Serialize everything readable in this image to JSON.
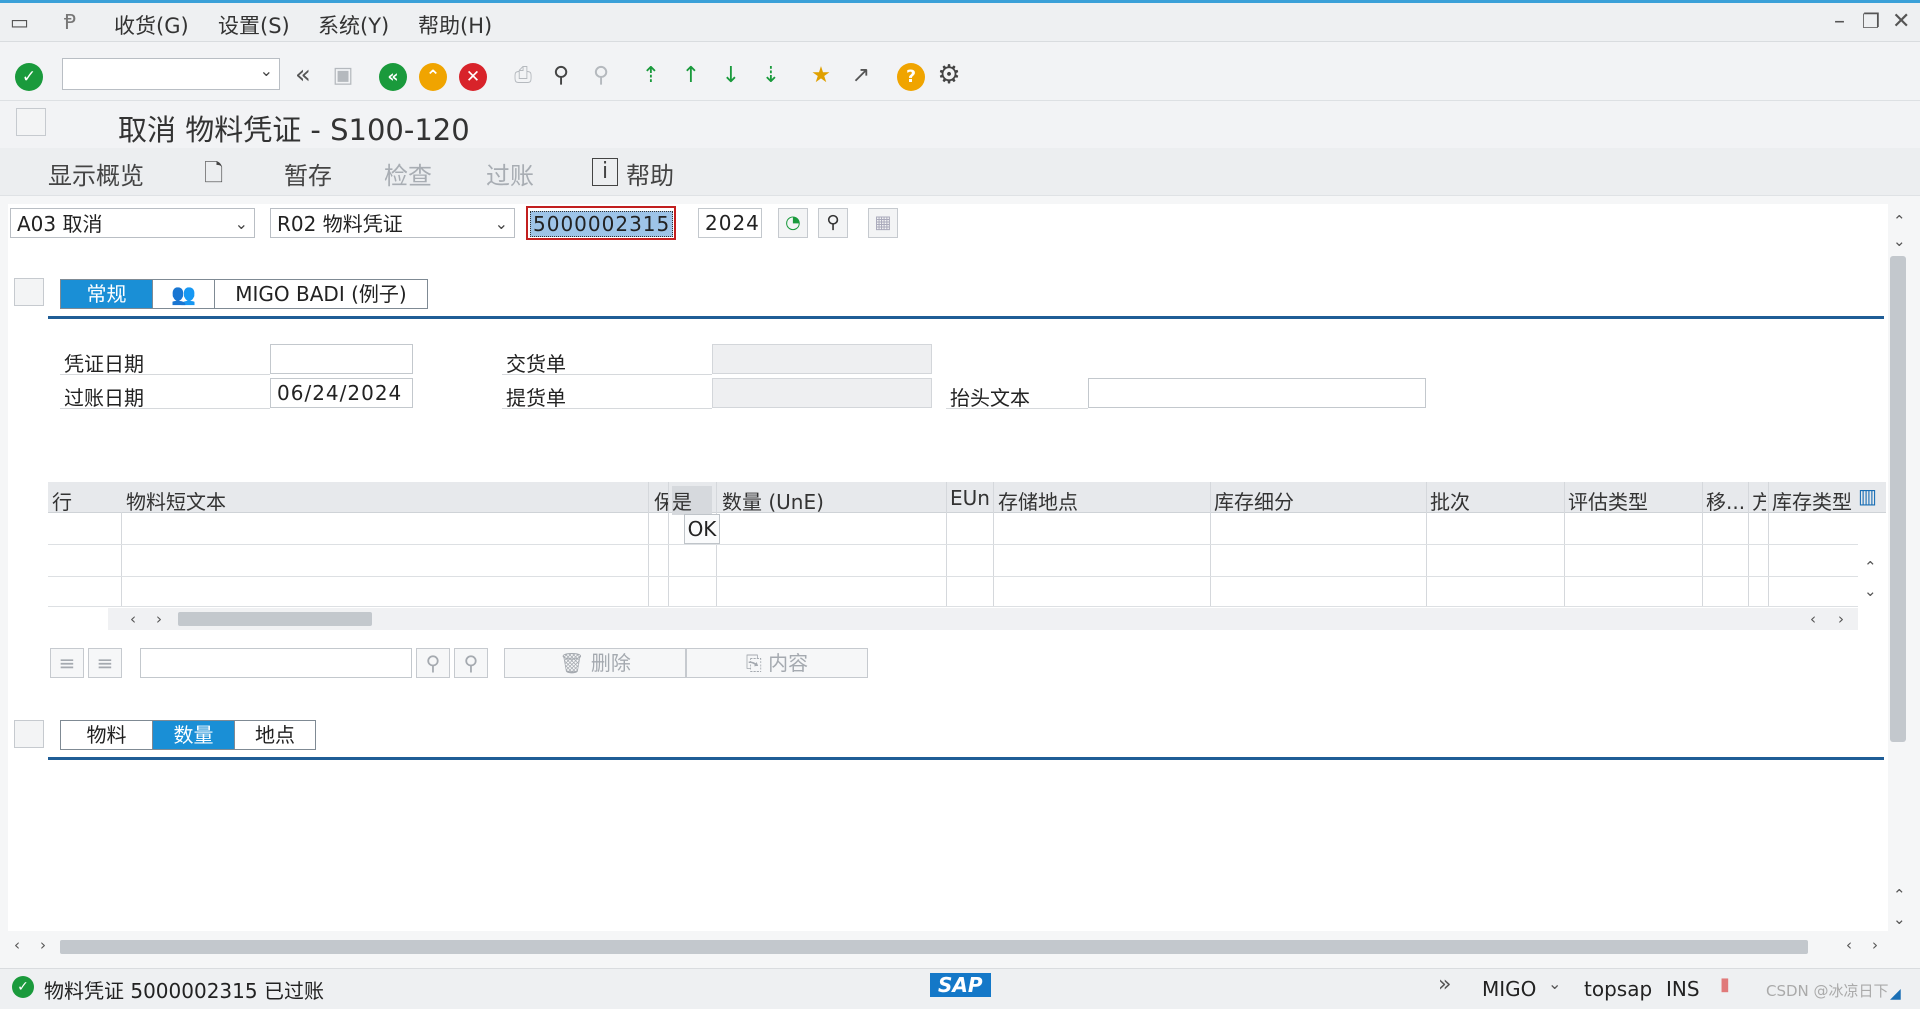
{
  "menu": {
    "items": [
      "收货(G)",
      "设置(S)",
      "系统(Y)",
      "帮助(H)"
    ]
  },
  "toolbar": {
    "command_value": "",
    "icons": [
      "enter-icon",
      "back-icon",
      "save-icon",
      "back-green-icon",
      "exit-icon",
      "cancel-icon",
      "print-icon",
      "find-icon",
      "find-next-icon",
      "first-page-icon",
      "prev-page-icon",
      "next-page-icon",
      "last-page-icon",
      "new-session-icon",
      "shortcut-icon",
      "help-icon",
      "settings-icon"
    ]
  },
  "title": "取消 物料凭证 - S100-120",
  "appbar": {
    "overview": "显示概览",
    "hold": "暂存",
    "check": "检查",
    "post": "过账",
    "help": "帮助"
  },
  "header": {
    "action": "A03 取消",
    "reference": "R02 物料凭证",
    "doc_number": "5000002315",
    "year": "2024"
  },
  "tabs_top": {
    "general": "常规",
    "badi": "MIGO BADI (例子)"
  },
  "fields": {
    "doc_date_label": "凭证日期",
    "doc_date_value": "",
    "post_date_label": "过账日期",
    "post_date_value": "06/24/2024",
    "delivery_note_label": "交货单",
    "bill_of_lading_label": "提货单",
    "header_text_label": "抬头文本",
    "header_text_value": ""
  },
  "grid": {
    "columns": [
      "行",
      "物料短文本",
      "保",
      "是",
      "数量 (UnE)",
      "EUn",
      "存储地点",
      "库存细分",
      "批次",
      "评估类型",
      "移...",
      "方",
      "库存类型"
    ],
    "ok_cell": "OK"
  },
  "grid_toolbar": {
    "delete": "删除",
    "content": "内容",
    "search_value": ""
  },
  "tabs_bottom": {
    "material": "物料",
    "quantity": "数量",
    "location": "地点"
  },
  "status": {
    "message": "物料凭证 5000002315 已过账",
    "transaction": "MIGO",
    "server": "topsap",
    "mode": "INS",
    "sap_logo": "SAP",
    "watermark": "CSDN @冰凉日下"
  },
  "colors": {
    "accent": "#1a8fd6",
    "ok_green": "#1a9a3c",
    "cancel_red": "#d8232a",
    "exit_orange": "#f0a400"
  }
}
